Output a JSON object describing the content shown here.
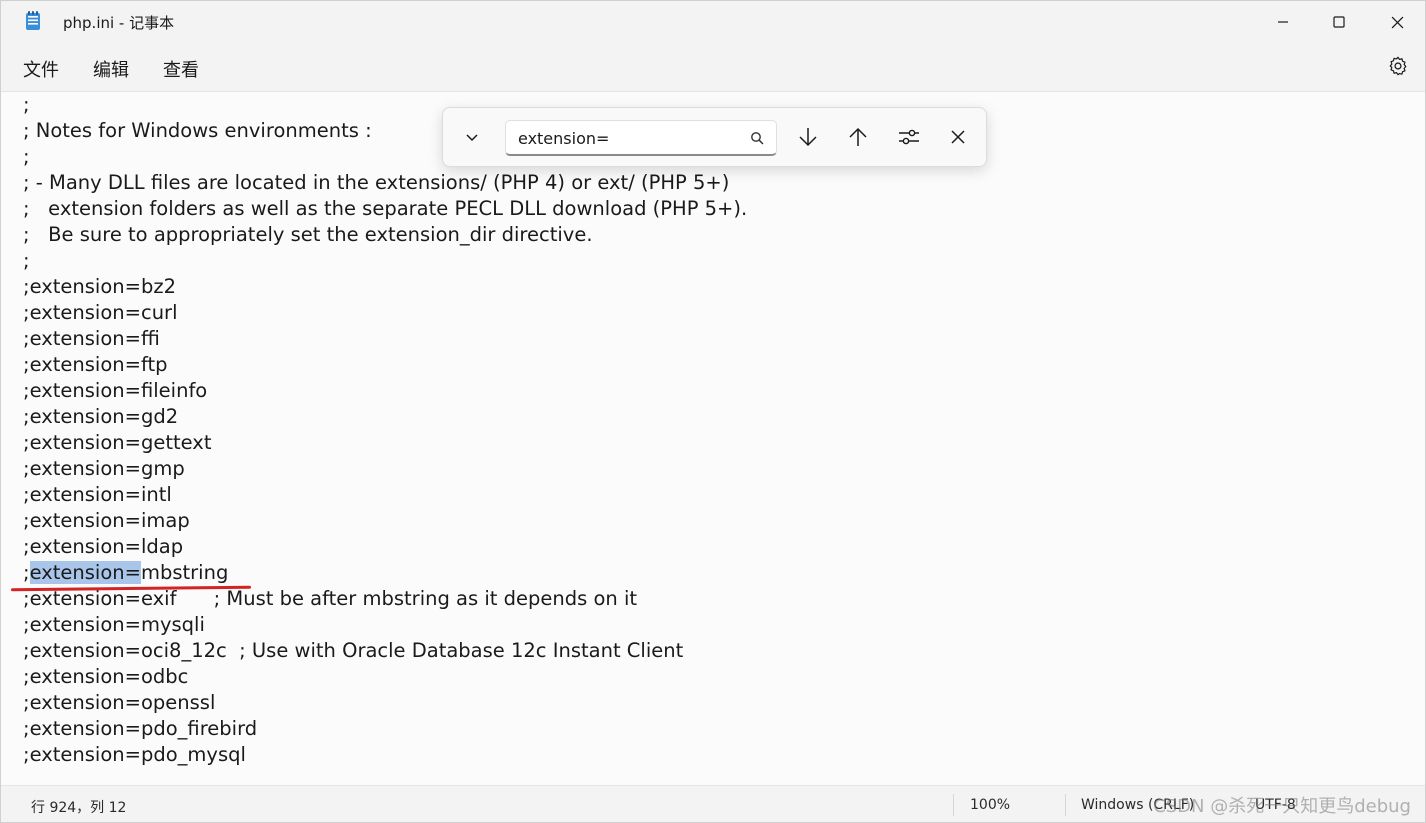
{
  "window": {
    "title": "php.ini - 记事本"
  },
  "menu": {
    "items": [
      "文件",
      "编辑",
      "查看"
    ]
  },
  "find": {
    "value": "extension="
  },
  "editor": {
    "lines": [
      ";",
      "; Notes for Windows environments :",
      ";",
      "; - Many DLL files are located in the extensions/ (PHP 4) or ext/ (PHP 5+)",
      ";   extension folders as well as the separate PECL DLL download (PHP 5+).",
      ";   Be sure to appropriately set the extension_dir directive.",
      ";",
      ";extension=bz2",
      ";extension=curl",
      ";extension=ffi",
      ";extension=ftp",
      ";extension=fileinfo",
      ";extension=gd2",
      ";extension=gettext",
      ";extension=gmp",
      ";extension=intl",
      ";extension=imap",
      ";extension=ldap",
      ";extension=mbstring",
      ";extension=exif      ; Must be after mbstring as it depends on it",
      ";extension=mysqli",
      ";extension=oci8_12c  ; Use with Oracle Database 12c Instant Client",
      ";extension=odbc",
      ";extension=openssl",
      ";extension=pdo_firebird",
      ";extension=pdo_mysql"
    ],
    "highlight": {
      "line_index": 18,
      "before": ";",
      "match": "extension=",
      "after": "mbstring"
    }
  },
  "status": {
    "position": "行 924，列 12",
    "zoom": "100%",
    "line_ending": "Windows (CRLF)",
    "encoding": "UTF-8",
    "watermark": "CSDN @杀死一只知更鸟debug"
  }
}
